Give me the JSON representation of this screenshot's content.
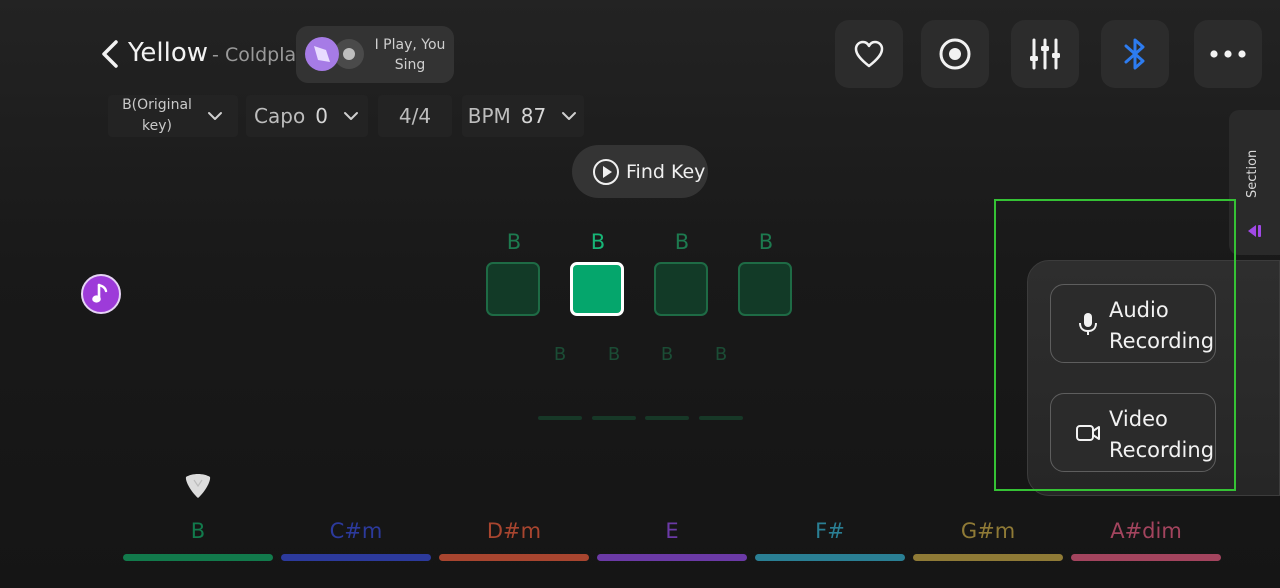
{
  "header": {
    "title": "Yellow",
    "artist": "- Coldplay",
    "play_sing_line1": "I Play, You",
    "play_sing_line2": "Sing"
  },
  "controls": {
    "key_line1": "B(Original",
    "key_line2": "key)",
    "capo_label": "Capo",
    "capo_value": "0",
    "time_signature": "4/4",
    "bpm_label": "BPM",
    "bpm_value": "87"
  },
  "find_key_label": "Find Key",
  "section_tab_label": "Section",
  "beats": {
    "top_chords": [
      "B",
      "B",
      "B",
      "B"
    ],
    "active_index": 1,
    "bottom_chords": [
      "B",
      "B",
      "B",
      "B"
    ]
  },
  "chord_bar": [
    {
      "name": "B",
      "color": "#127a4c"
    },
    {
      "name": "C#m",
      "color": "#2c3a9c"
    },
    {
      "name": "D#m",
      "color": "#a8452f"
    },
    {
      "name": "E",
      "color": "#6b3aa6"
    },
    {
      "name": "F#",
      "color": "#2a7f94"
    },
    {
      "name": "G#m",
      "color": "#8f7a36"
    },
    {
      "name": "A#dim",
      "color": "#a3445e"
    }
  ],
  "recording": {
    "audio_line1": "Audio",
    "audio_line2": "Recording",
    "video_line1": "Video",
    "video_line2": "Recording"
  },
  "icons": {
    "header_buttons": [
      "heart-icon",
      "record-icon",
      "mixer-icon",
      "bluetooth-icon",
      "more-icon"
    ],
    "bluetooth_color": "#2d7cf0",
    "accent_green": "#05a66c"
  }
}
